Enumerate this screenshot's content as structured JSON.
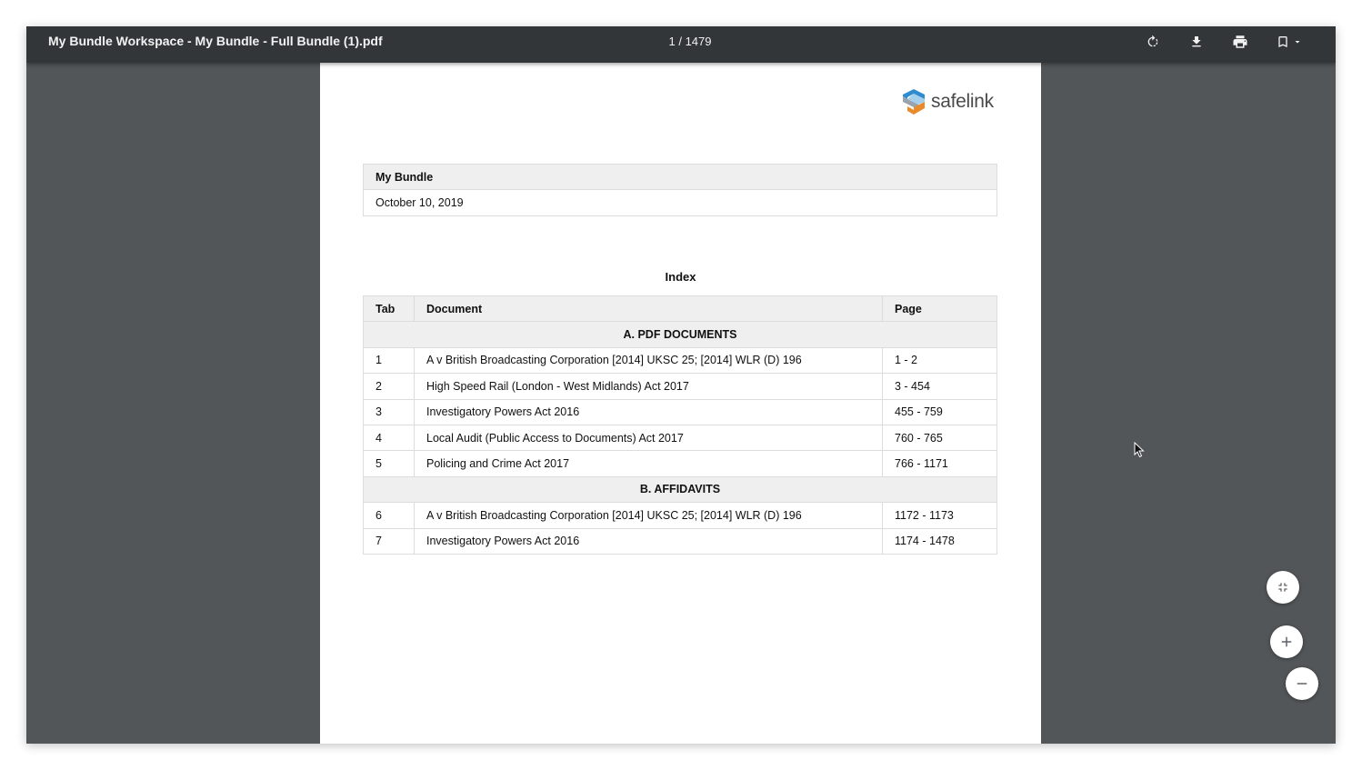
{
  "toolbar": {
    "title": "My Bundle Workspace - My Bundle - Full Bundle (1).pdf",
    "page_indicator": "1 / 1479",
    "icons": [
      "rotate-icon",
      "download-icon",
      "print-icon",
      "bookmark-icon",
      "caret-down-icon"
    ]
  },
  "document": {
    "logo_text": "safelink",
    "bundle_name": "My Bundle",
    "date": "October 10, 2019",
    "index_heading": "Index",
    "columns": [
      "Tab",
      "Document",
      "Page"
    ],
    "sections": [
      {
        "title": "A. PDF DOCUMENTS",
        "rows": [
          {
            "tab": "1",
            "document": "A v British Broadcasting Corporation [2014] UKSC 25;  [2014] WLR (D)  196",
            "page": "1 - 2"
          },
          {
            "tab": "2",
            "document": "High Speed Rail (London - West Midlands) Act 2017",
            "page": "3 - 454"
          },
          {
            "tab": "3",
            "document": "Investigatory Powers Act 2016",
            "page": "455 - 759"
          },
          {
            "tab": "4",
            "document": "Local Audit (Public Access to Documents) Act 2017",
            "page": "760 - 765"
          },
          {
            "tab": "5",
            "document": "Policing and Crime Act 2017",
            "page": "766 - 1171"
          }
        ]
      },
      {
        "title": "B. AFFIDAVITS",
        "rows": [
          {
            "tab": "6",
            "document": "A v British Broadcasting Corporation [2014] UKSC 25;  [2014] WLR (D)  196",
            "page": "1172 - 1173"
          },
          {
            "tab": "7",
            "document": "Investigatory Powers Act 2016",
            "page": "1174 - 1478"
          }
        ]
      }
    ]
  },
  "zoom_controls": {
    "icons": [
      "fit-page-icon",
      "zoom-in-icon",
      "zoom-out-icon"
    ]
  },
  "colors": {
    "toolbar_bg": "#323639",
    "viewer_bg": "#525659",
    "logo_blue": "#2f8ccf",
    "logo_orange": "#e98a2b",
    "logo_grey": "#9aa3ab"
  }
}
